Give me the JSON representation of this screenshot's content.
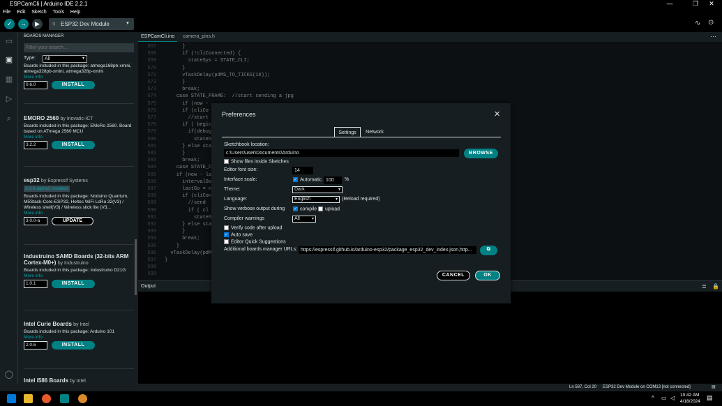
{
  "window": {
    "title": "ESPCamCli | Arduino IDE 2.2.1",
    "minimize": "—",
    "maximize": "❐",
    "close": "✕"
  },
  "menu": [
    "File",
    "Edit",
    "Sketch",
    "Tools",
    "Help"
  ],
  "toolbar": {
    "board": "ESP32 Dev Module"
  },
  "boards_manager": {
    "header": "BOARDS MANAGER",
    "search_placeholder": "Filter your search...",
    "type_label": "Type:",
    "type_value": "All",
    "items": [
      {
        "name": "",
        "by": "",
        "desc": "Boards included in this package: atmega168pb-xmini, atmega328pb-xmini, atmega328p-xmini",
        "more": "More info",
        "version": "0.6.0",
        "action": "INSTALL"
      },
      {
        "name": "EMORO 2560",
        "by": "by Inovatic-ICT",
        "desc": "Boards included in this package: EMoRo 2560. Board based on ATmega 2560 MCU",
        "more": "More info",
        "version": "3.2.2",
        "action": "INSTALL"
      },
      {
        "name": "esp32",
        "by": "by Espressif Systems",
        "tag": "3.0.0-alpha3 installed",
        "desc": "Boards included in this package: Noduino Quantum, M5Stack-Core-ESP32, Heltec WiFi LoRa 32(V3) / Wireless shell(V3) / Wireless stick lite (V3...",
        "more": "More info",
        "version": "3.0.0-a",
        "action": "UPDATE"
      },
      {
        "name": "Industruino SAMD Boards (32-bits ARM Cortex-M0+)",
        "by": "by Industruino",
        "desc": "Boards included in this package: Industruino D21G",
        "more": "More info",
        "version": "1.0.1",
        "action": "INSTALL"
      },
      {
        "name": "Intel Curie Boards",
        "by": "by Intel",
        "desc": "Boards included in this package: Arduino 101",
        "more": "More info",
        "version": "2.0.6",
        "action": "INSTALL"
      },
      {
        "name": "Intel i586 Boards",
        "by": "by Intel",
        "desc": "",
        "more": "",
        "version": "",
        "action": ""
      }
    ]
  },
  "tabs": [
    "ESPCamCli.ino",
    "camera_pins.h"
  ],
  "code_lines": [
    {
      "n": "567",
      "t": "      }"
    },
    {
      "n": "568",
      "t": "      if (!cliConnected) {"
    },
    {
      "n": "569",
      "t": "        stateSys = STATE_CLI;"
    },
    {
      "n": "570",
      "t": "      }"
    },
    {
      "n": "571",
      "t": "      vTaskDelay(pdMS_TO_TICKS(10));"
    },
    {
      "n": "572",
      "t": "      }"
    },
    {
      "n": "573",
      "t": "      break;"
    },
    {
      "n": "574",
      "t": "    case STATE_FRAME:  //start sending a jpg"
    },
    {
      "n": "575",
      "t": "      if (now - "
    },
    {
      "n": "576",
      "t": "      if (cliCo"
    },
    {
      "n": "577",
      "t": "        //start"
    },
    {
      "n": "578",
      "t": "      if ( begin"
    },
    {
      "n": "579",
      "t": "        if(debug"
    },
    {
      "n": "580",
      "t": "          stateSy"
    },
    {
      "n": "581",
      "t": "      } else sta"
    },
    {
      "n": "582",
      "t": "      }"
    },
    {
      "n": "583",
      "t": "      break;"
    },
    {
      "n": "584",
      "t": "    case STATE_C"
    },
    {
      "n": "585",
      "t": "    if (now - la"
    },
    {
      "n": "586",
      "t": "      intervalGo"
    },
    {
      "n": "587",
      "t": "      lastGo = n"
    },
    {
      "n": "588",
      "t": "      if (cliCon"
    },
    {
      "n": "589",
      "t": "        //send"
    },
    {
      "n": "590",
      "t": "        if ( cl"
    },
    {
      "n": "591",
      "t": "          stateSys"
    },
    {
      "n": "592",
      "t": "      } else sta"
    },
    {
      "n": "593",
      "t": "      }"
    },
    {
      "n": "594",
      "t": "      break;"
    },
    {
      "n": "595",
      "t": "    }"
    },
    {
      "n": "596",
      "t": "  vTaskDelay(pdM"
    },
    {
      "n": "597",
      "t": "}"
    },
    {
      "n": "598",
      "t": ""
    },
    {
      "n": "599",
      "t": ""
    }
  ],
  "output": {
    "label": "Output"
  },
  "status": {
    "position": "Ln 587, Col 20",
    "board": "ESP32 Dev Module on COM13 [not connected]"
  },
  "taskbar": {
    "time": "10:42 AM",
    "date": "4/18/2024"
  },
  "preferences": {
    "title": "Preferences",
    "close": "✕",
    "tabs": {
      "settings": "Settings",
      "network": "Network"
    },
    "sketchbook_label": "Sketchbook location:",
    "sketchbook_value": "c:\\Users\\user\\Documents\\Arduino",
    "browse": "BROWSE",
    "show_files": "Show files inside Sketches",
    "font_size_label": "Editor font size:",
    "font_size_value": "14",
    "scale_label": "Interface scale:",
    "scale_auto": "Automatic",
    "scale_value": "100",
    "scale_unit": "%",
    "theme_label": "Theme:",
    "theme_value": "Dark",
    "language_label": "Language:",
    "language_value": "English",
    "reload_note": "(Reload required)",
    "verbose_label": "Show verbose output during",
    "verbose_compile": "compile",
    "verbose_upload": "upload",
    "warnings_label": "Compiler warnings",
    "warnings_value": "All",
    "verify": "Verify code after upload",
    "autosave": "Auto save",
    "quick": "Editor Quick Suggestions",
    "urls_label": "Additional boards manager URLs:",
    "urls_value": "https://espressif.github.io/arduino-esp32/package_esp32_dev_index.json,http...",
    "cancel": "CANCEL",
    "ok": "OK"
  },
  "colors": {
    "accent": "#008184",
    "bg": "#171e21"
  }
}
